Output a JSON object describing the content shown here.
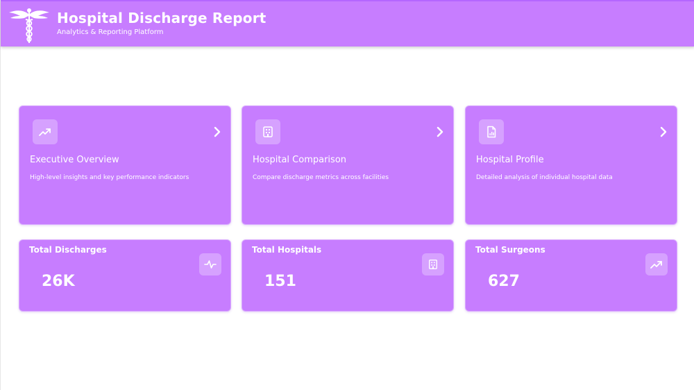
{
  "header": {
    "title": "Hospital Discharge Report",
    "subtitle": "Analytics & Reporting Platform",
    "logo_icon": "caduceus-icon"
  },
  "nav_cards": [
    {
      "title": "Executive Overview",
      "description": "High-level insights and key performance indicators",
      "icon": "trending-up-icon"
    },
    {
      "title": "Hospital Comparison",
      "description": "Compare discharge metrics across facilities",
      "icon": "hospital-building-icon"
    },
    {
      "title": "Hospital Profile",
      "description": "Detailed analysis of individual hospital data",
      "icon": "document-chart-icon"
    }
  ],
  "stats": [
    {
      "label": "Total Discharges",
      "value": "26K",
      "icon": "activity-pulse-icon"
    },
    {
      "label": "Total Hospitals",
      "value": "151",
      "icon": "hospital-building-icon"
    },
    {
      "label": "Total Surgeons",
      "value": "627",
      "icon": "trending-up-icon"
    }
  ],
  "colors": {
    "accent": "#c77dff",
    "text_on_accent": "#ffffff",
    "background": "#ffffff"
  }
}
